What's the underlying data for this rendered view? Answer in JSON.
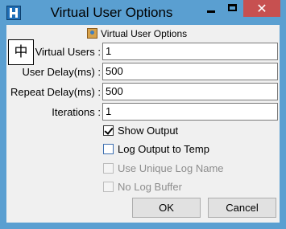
{
  "window": {
    "title": "Virtual User Options",
    "buttons": {
      "minimize": "minimize-icon",
      "maximize": "maximize-icon",
      "close": "✕"
    }
  },
  "dialog": {
    "heading": "Virtual User Options",
    "ime_indicator": "中",
    "fields": {
      "virtual_users": {
        "label": "Virtual Users :",
        "value": "1"
      },
      "user_delay": {
        "label": "User Delay(ms) :",
        "value": "500"
      },
      "repeat_delay": {
        "label": "Repeat Delay(ms) :",
        "value": "500"
      },
      "iterations": {
        "label": "Iterations :",
        "value": "1"
      }
    },
    "options": {
      "show_output": {
        "label": "Show Output",
        "checked": true,
        "enabled": true
      },
      "log_output": {
        "label": "Log Output to Temp",
        "checked": false,
        "enabled": true
      },
      "unique_log": {
        "label": "Use Unique Log Name",
        "checked": false,
        "enabled": false
      },
      "no_log_buffer": {
        "label": "No Log Buffer",
        "checked": false,
        "enabled": false
      }
    },
    "ok_label": "OK",
    "cancel_label": "Cancel"
  },
  "colors": {
    "frame": "#5a9fd1",
    "close_button": "#c75050",
    "client_bg": "#f0f0f0"
  }
}
